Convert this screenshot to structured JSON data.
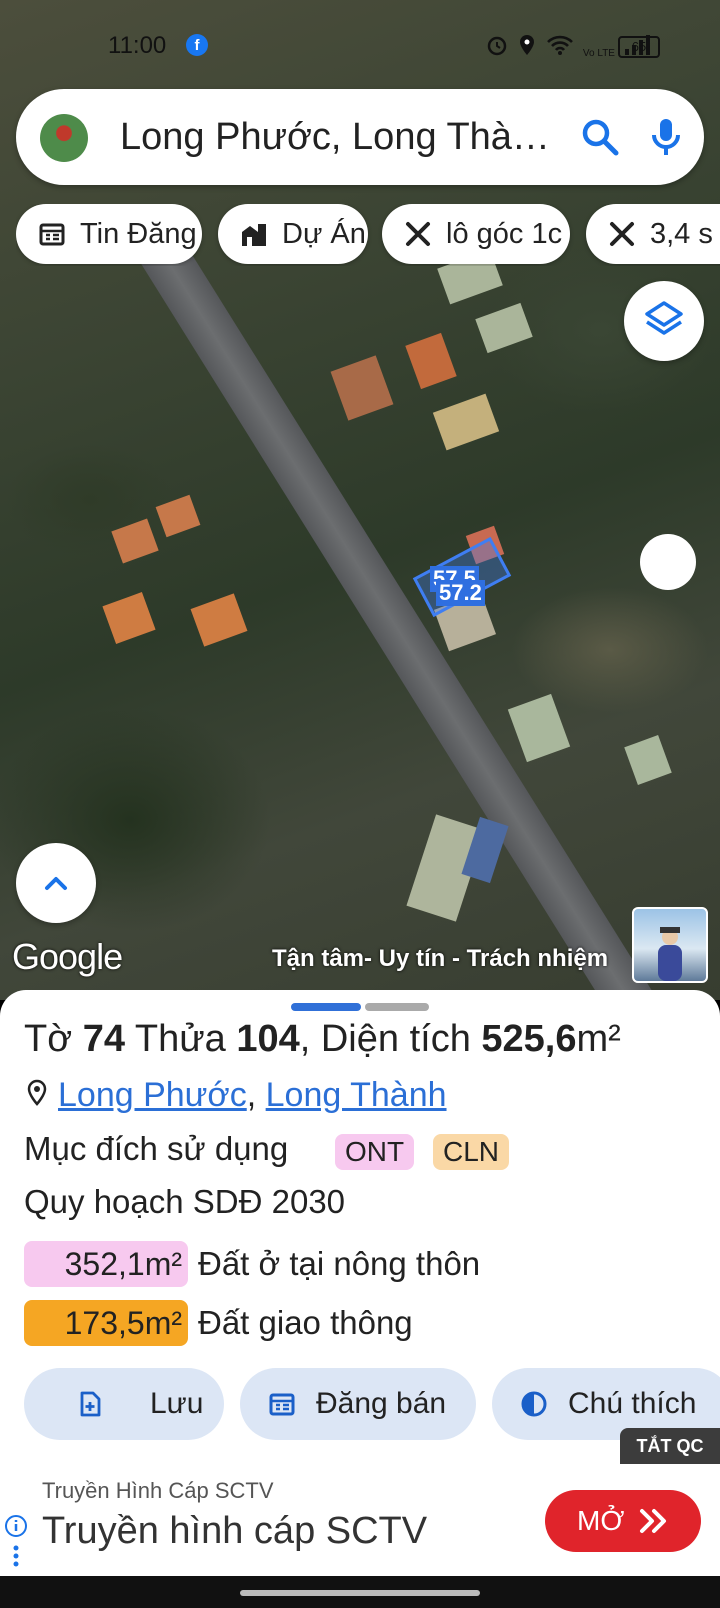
{
  "status_bar": {
    "time": "11:00",
    "app_badge": "f",
    "network": "Vo LTE",
    "battery": "65"
  },
  "search": {
    "text": "Long Phước, Long Thà…",
    "avatar_icon": "user-avatar",
    "search_icon": "search-icon",
    "mic_icon": "mic-icon"
  },
  "chips": [
    {
      "label": "Tin Đăng",
      "icon": "calendar-list-icon"
    },
    {
      "label": "Dự Án",
      "icon": "building-icon"
    },
    {
      "label": "lô góc 1c",
      "icon": "ruler-pencil-icon"
    },
    {
      "label": "3,4 s",
      "icon": "ruler-pencil-icon"
    }
  ],
  "map": {
    "parcel_labels": [
      "57.5",
      "57.2"
    ],
    "attribution": "Google",
    "slogan": "Tận tâm- Uy tín - Trách nhiệm"
  },
  "parcel": {
    "title_prefix": "Tờ",
    "sheet_no": "74",
    "plot_label": "Thửa",
    "plot_no": "104",
    "area_label": ", Diện tích",
    "area_value": "525,6",
    "area_unit": "m²",
    "sep": ",",
    "ward": "Long Phước",
    "district": "Long Thành",
    "purpose_label": "Mục đích sử dụng",
    "purpose_tags": [
      "ONT",
      "CLN"
    ],
    "plan_label": "Quy hoạch SDĐ 2030",
    "land_uses": [
      {
        "area": "352,1m²",
        "label": "Đất ở tại nông thôn",
        "color": "#f7c9ef"
      },
      {
        "area": "173,5m²",
        "label": "Đất giao thông",
        "color": "#f5a623"
      }
    ]
  },
  "actions": [
    {
      "label": "Lưu",
      "icon": "file-add-icon"
    },
    {
      "label": "Đăng bán",
      "icon": "calendar-list-icon"
    },
    {
      "label": "Chú thích",
      "icon": "contrast-icon"
    }
  ],
  "ad": {
    "close_label": "TẮT QC",
    "sponsor": "Truyền Hình Cáp SCTV",
    "headline": "Truyền hình cáp SCTV",
    "cta": "MỞ",
    "cta_color": "#e0242b"
  },
  "colors": {
    "accent": "#2b6fd6",
    "chip_bg": "#ffffff",
    "action_bg": "#dce6f5"
  }
}
